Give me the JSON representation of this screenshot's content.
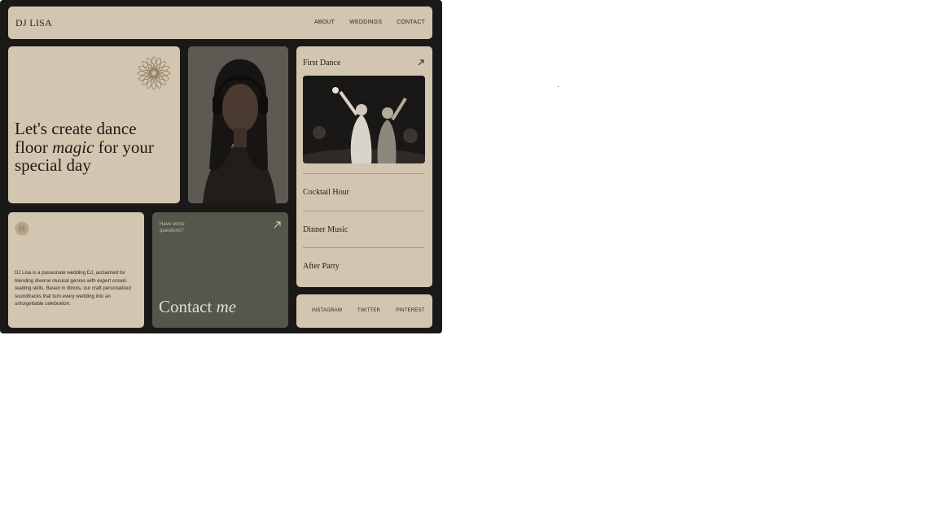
{
  "header": {
    "logo": "DJ LISA",
    "nav": [
      "ABOUT",
      "WEDDINGS",
      "CONTACT"
    ]
  },
  "hero": {
    "line1": "Let's create dance",
    "line2_prefix": "floor ",
    "line2_em": "magic",
    "line2_suffix": " for your",
    "line3": "special day"
  },
  "about": {
    "text": "DJ Lisa is a passionate wedding DJ, acclaimed for blending diverse musical genres with expert crowd-reading skills. Based in Illinois, our craft personalized soundtracks that turn every wedding into an unforgettable celebration."
  },
  "contact": {
    "question": "Have some questions?",
    "title": "Contact ",
    "title_em": "me"
  },
  "events": {
    "featured": "First Dance",
    "items": [
      "Cocktail Hour",
      "Dinner Music",
      "After Party"
    ]
  },
  "socials": [
    "INSTAGRAM",
    "TWITTER",
    "PINTEREST"
  ],
  "colors": {
    "frame": "#1b1917",
    "card": "#d3c6b1",
    "contact_card": "#55564c",
    "text_dark": "#1f1b17"
  },
  "icons": {
    "flower": "mandala-flower-icon",
    "arrow": "arrow-up-right-icon",
    "badge": "flower-badge-icon"
  }
}
